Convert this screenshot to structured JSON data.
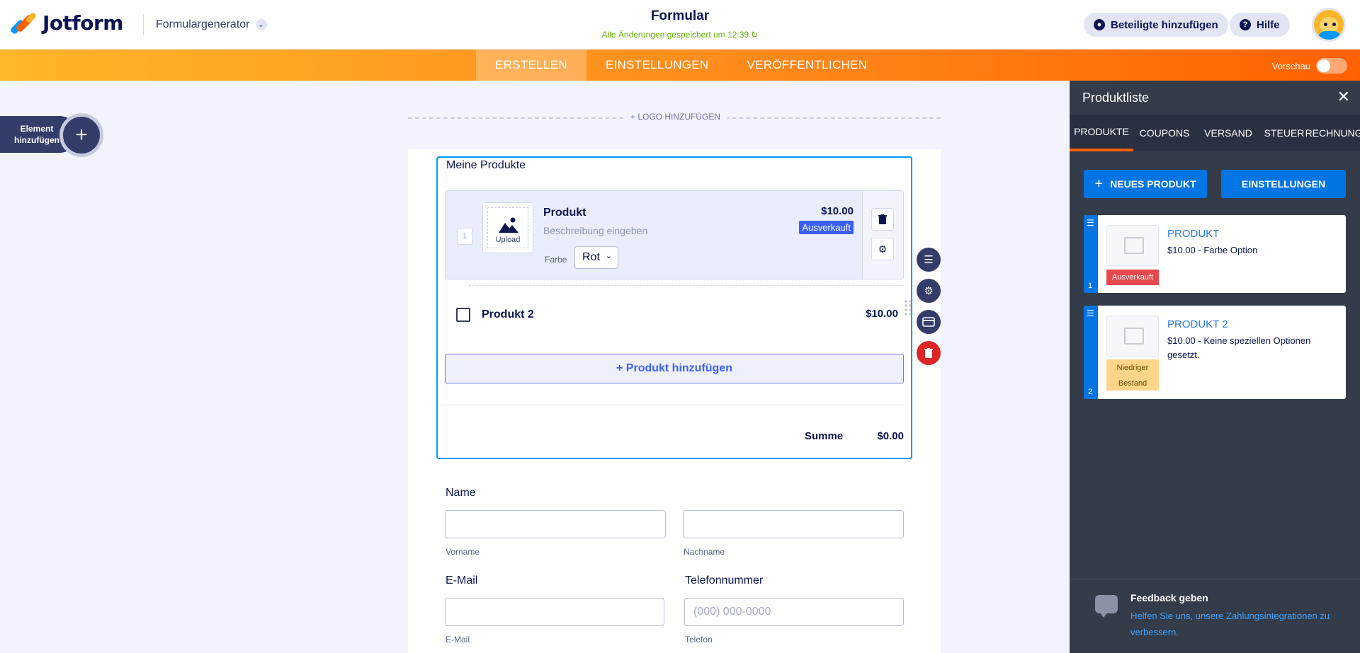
{
  "header": {
    "brand": "Jotform",
    "product_menu": "Formulargenerator",
    "form_title": "Formular",
    "save_status": "Alle Änderungen gespeichert um 12:39 ↻",
    "add_participants": "Beteiligte hinzufügen",
    "help": "Hilfe"
  },
  "nav": {
    "tabs": [
      "ERSTELLEN",
      "EINSTELLUNGEN",
      "VERÖFFENTLICHEN"
    ],
    "preview_label": "Vorschau"
  },
  "add_element": {
    "label": "Element hinzufügen",
    "plus": "+"
  },
  "form": {
    "add_logo": "+ LOGO HINZUFÜGEN",
    "products_title": "Meine Produkte",
    "product1": {
      "index": "1",
      "upload": "Upload",
      "name": "Produkt",
      "description_placeholder": "Beschreibung eingeben",
      "option_label": "Farbe",
      "option_value": "Rot",
      "price": "$10.00",
      "badge": "Ausverkauft"
    },
    "product2": {
      "name": "Produkt 2",
      "price": "$10.00"
    },
    "add_product": "+ Produkt hinzufügen",
    "total_label": "Summe",
    "total_value": "$0.00",
    "name_label": "Name",
    "first_name_sub": "Vorname",
    "last_name_sub": "Nachname",
    "email_label": "E-Mail",
    "email_sub": "E-Mail",
    "phone_label": "Telefonnummer",
    "phone_placeholder": "(000) 000-0000",
    "phone_sub": "Telefon"
  },
  "panel": {
    "title": "Produktliste",
    "tabs": [
      "PRODUKTE",
      "COUPONS",
      "VERSAND",
      "STEUER",
      "RECHNUNG"
    ],
    "new_product": "NEUES PRODUKT",
    "settings": "EINSTELLUNGEN",
    "products": [
      {
        "num": "1",
        "name": "PRODUKT",
        "desc": "$10.00 - Farbe Option",
        "badge": "Ausverkauft",
        "badge_color": "#e5484d"
      },
      {
        "num": "2",
        "name": "PRODUKT 2",
        "desc": "$10.00 - Keine speziellen Optionen gesetzt.",
        "badge": "Niedriger Bestand",
        "badge_color": "#ffd58a"
      }
    ],
    "feedback_title": "Feedback geben",
    "feedback_text": "Helfen Sie uns, unsere Zahlungsintegrationen zu verbessern."
  },
  "colors": {
    "accent_orange": "#ff6100",
    "accent_blue": "#0099ff",
    "navy": "#0a1551",
    "panel_bg": "#343c4a"
  }
}
